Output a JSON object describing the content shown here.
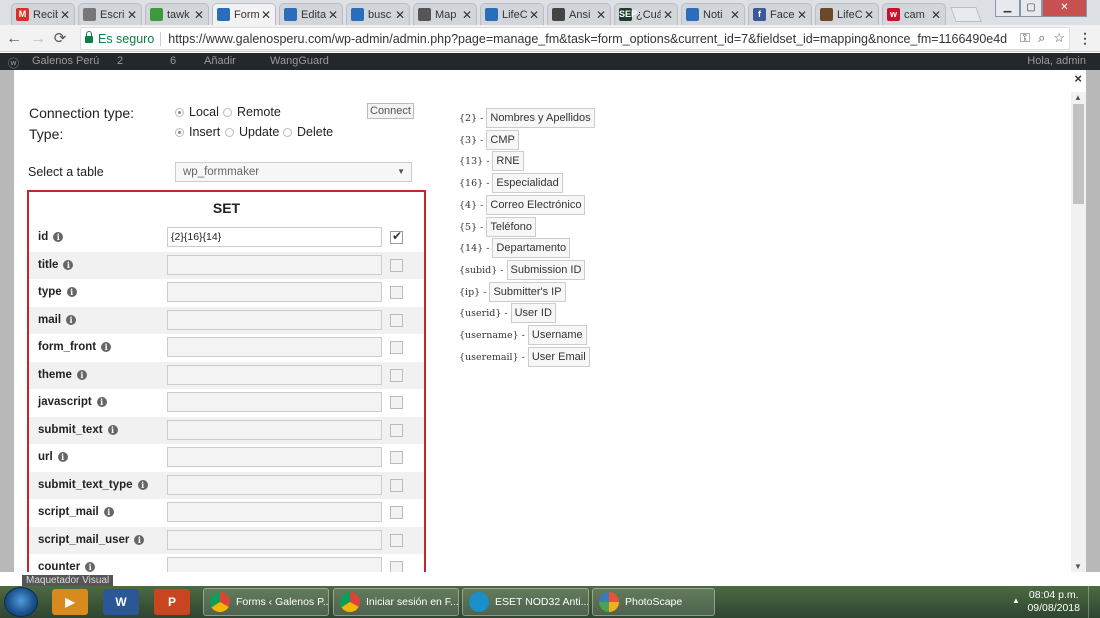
{
  "browser": {
    "tabs": [
      {
        "label": "Recib",
        "icon": "gmail-icon",
        "color": "#d93025",
        "glyph": "M",
        "active": false
      },
      {
        "label": "Escri",
        "icon": "document-icon",
        "color": "#777777",
        "glyph": "",
        "active": false
      },
      {
        "label": "tawk",
        "icon": "tawk-icon",
        "color": "#3c9a3c",
        "glyph": "",
        "active": false
      },
      {
        "label": "Form",
        "icon": "wordpress-icon",
        "color": "#2a6ebb",
        "glyph": "",
        "active": true
      },
      {
        "label": "Edita",
        "icon": "wordpress-icon",
        "color": "#2a6ebb",
        "glyph": "",
        "active": false
      },
      {
        "label": "busc",
        "icon": "wordpress-icon",
        "color": "#2a6ebb",
        "glyph": "",
        "active": false
      },
      {
        "label": "Map",
        "icon": "globe-icon",
        "color": "#555555",
        "glyph": "",
        "active": false
      },
      {
        "label": "LifeC",
        "icon": "wordpress-icon",
        "color": "#2a6ebb",
        "glyph": "",
        "active": false
      },
      {
        "label": "Ansi",
        "icon": "ansi-icon",
        "color": "#444444",
        "glyph": "",
        "active": false
      },
      {
        "label": "¿Cuá",
        "icon": "sep-icon",
        "color": "#1d3d2d",
        "glyph": "SEP",
        "active": false
      },
      {
        "label": "Noti",
        "icon": "wordpress-icon",
        "color": "#2a6ebb",
        "glyph": "",
        "active": false
      },
      {
        "label": "Face",
        "icon": "facebook-icon",
        "color": "#3b5998",
        "glyph": "f",
        "active": false
      },
      {
        "label": "LifeC",
        "icon": "lifec-icon",
        "color": "#6b4a2a",
        "glyph": "",
        "active": false
      },
      {
        "label": "cam",
        "icon": "camera-icon",
        "color": "#c8102e",
        "glyph": "w",
        "active": false
      }
    ],
    "secure_label": "Es seguro",
    "url": "https://www.galenosperu.com/wp-admin/admin.php?page=manage_fm&task=form_options&current_id=7&fieldset_id=mapping&nonce_fm=1166490e4d"
  },
  "adminbar": {
    "site": "Galenos Perú",
    "updates": "2",
    "comments": "6",
    "new": "Añadir",
    "plugin": "WangGuard",
    "greeting": "Hola, admin"
  },
  "form": {
    "connection_type_label": "Connection type:",
    "type_label": "Type:",
    "connection_options": [
      {
        "label": "Local",
        "checked": true
      },
      {
        "label": "Remote",
        "checked": false
      }
    ],
    "type_options": [
      {
        "label": "Insert",
        "checked": true
      },
      {
        "label": "Update",
        "checked": false
      },
      {
        "label": "Delete",
        "checked": false
      }
    ],
    "connect_label": "Connect",
    "select_table_label": "Select a table",
    "table_value": "wp_formmaker",
    "set_title": "SET",
    "fields": [
      {
        "name": "id",
        "value": "{2}{16}{14}",
        "checked": true
      },
      {
        "name": "title",
        "value": "",
        "checked": false
      },
      {
        "name": "type",
        "value": "",
        "checked": false
      },
      {
        "name": "mail",
        "value": "",
        "checked": false
      },
      {
        "name": "form_front",
        "value": "",
        "checked": false
      },
      {
        "name": "theme",
        "value": "",
        "checked": false
      },
      {
        "name": "javascript",
        "value": "",
        "checked": false
      },
      {
        "name": "submit_text",
        "value": "",
        "checked": false
      },
      {
        "name": "url",
        "value": "",
        "checked": false
      },
      {
        "name": "submit_text_type",
        "value": "",
        "checked": false
      },
      {
        "name": "script_mail",
        "value": "",
        "checked": false
      },
      {
        "name": "script_mail_user",
        "value": "",
        "checked": false
      },
      {
        "name": "counter",
        "value": "",
        "checked": false
      }
    ]
  },
  "mapping": [
    {
      "code": "{2} -",
      "label": "Nombres y Apellidos"
    },
    {
      "code": "{3} -",
      "label": "CMP"
    },
    {
      "code": "{13} -",
      "label": "RNE"
    },
    {
      "code": "{16} -",
      "label": "Especialidad"
    },
    {
      "code": "{4} -",
      "label": "Correo Electrónico"
    },
    {
      "code": "{5} -",
      "label": "Teléfono"
    },
    {
      "code": "{14} -",
      "label": "Departamento"
    },
    {
      "code": "{subid} -",
      "label": "Submission ID"
    },
    {
      "code": "{ip} -",
      "label": "Submitter's IP"
    },
    {
      "code": "{userid} -",
      "label": "User ID"
    },
    {
      "code": "{username} -",
      "label": "Username"
    },
    {
      "code": "{useremail} -",
      "label": "User Email"
    }
  ],
  "footer_hint": "Maquetador Visual",
  "taskbar": {
    "tasks": [
      {
        "label": "Forms ‹ Galenos P...",
        "icon": "chrome-icon"
      },
      {
        "label": "Iniciar sesión en F...",
        "icon": "chrome-icon"
      },
      {
        "label": "ESET NOD32 Anti...",
        "icon": "eset-icon"
      },
      {
        "label": "PhotoScape",
        "icon": "photoscape-icon"
      }
    ],
    "time": "08:04 p.m.",
    "date": "09/08/2018"
  }
}
